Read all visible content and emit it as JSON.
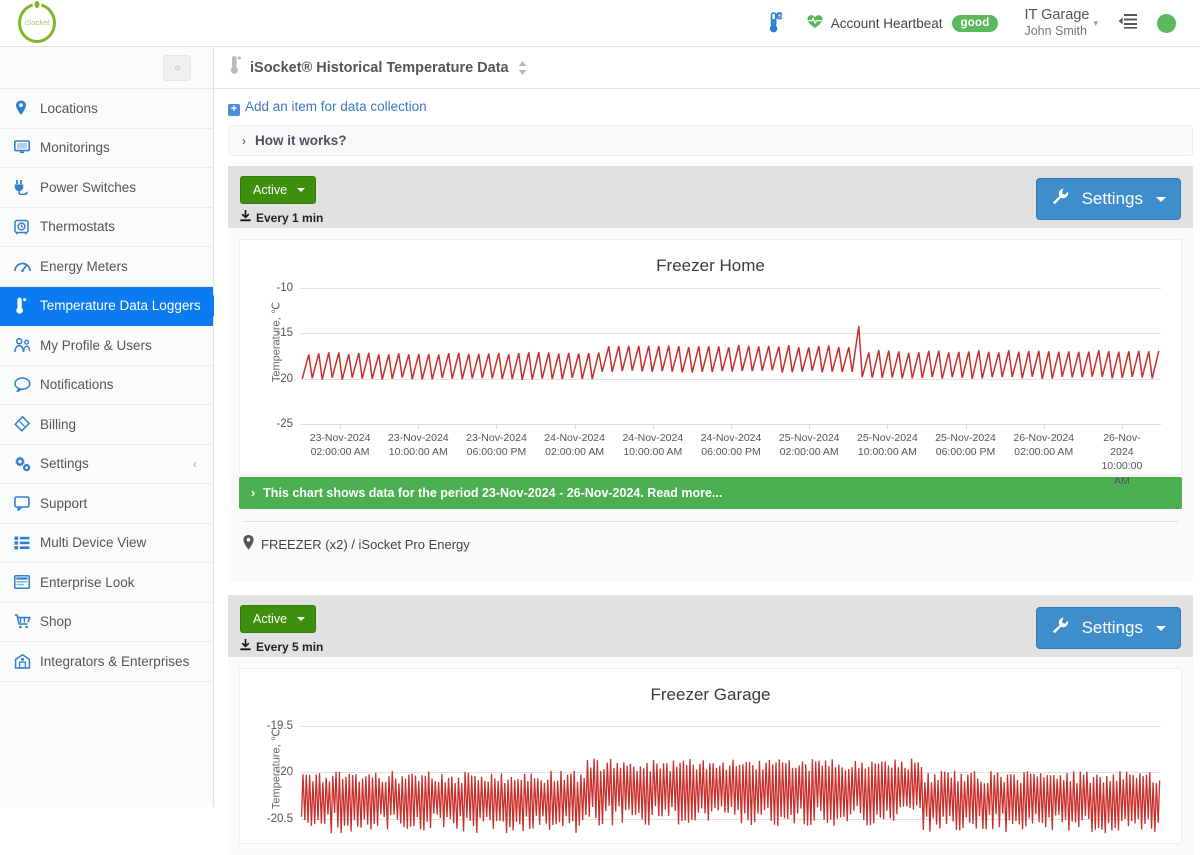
{
  "brand": {
    "name": "iSocket",
    "logo_text": "iSocket",
    "accent_green": "#7cb925"
  },
  "topbar": {
    "thermo_icon": "thermometer-celsius-icon",
    "heartbeat_icon": "heart-pulse-icon",
    "heartbeat_label": "Account Heartbeat",
    "heartbeat_status": "good",
    "account_name": "IT Garage",
    "user_name": "John Smith",
    "caret": "⌄",
    "list_icon": "indent-list-icon",
    "status_dot": "online-status-dot",
    "status_color": "#5cb85c"
  },
  "sidebar": {
    "collapse_label": "‹›",
    "items": [
      {
        "label": "Locations",
        "icon": "map-pin-icon",
        "active": false
      },
      {
        "label": "Monitorings",
        "icon": "monitor-icon",
        "active": false
      },
      {
        "label": "Power Switches",
        "icon": "plug-icon",
        "active": false
      },
      {
        "label": "Thermostats",
        "icon": "thermostat-icon",
        "active": false
      },
      {
        "label": "Energy Meters",
        "icon": "gauge-icon",
        "active": false
      },
      {
        "label": "Temperature Data Loggers",
        "icon": "thermometer-icon",
        "active": true
      },
      {
        "label": "My Profile & Users",
        "icon": "users-icon",
        "active": false
      },
      {
        "label": "Notifications",
        "icon": "speech-bubble-icon",
        "active": false
      },
      {
        "label": "Billing",
        "icon": "tag-icon",
        "active": false
      },
      {
        "label": "Settings",
        "icon": "gears-icon",
        "active": false,
        "chevron": "‹"
      },
      {
        "label": "Support",
        "icon": "support-chat-icon",
        "active": false
      },
      {
        "label": "Multi Device View",
        "icon": "list-grid-icon",
        "active": false
      },
      {
        "label": "Enterprise Look",
        "icon": "window-icon",
        "active": false
      },
      {
        "label": "Shop",
        "icon": "cart-icon",
        "active": false
      },
      {
        "label": "Integrators & Enterprises",
        "icon": "network-icon",
        "active": false
      }
    ]
  },
  "page": {
    "title": "iSocket® Historical Temperature Data",
    "title_icon": "thermometer-icon",
    "sort_icon": "sort-updown-icon",
    "add_item_label": "Add an item for data collection",
    "add_icon": "plus-square-icon",
    "how_it_works_label": "How it works?",
    "how_it_works_chevron": "›"
  },
  "cards": [
    {
      "status_label": "Active",
      "status_caret": "▾",
      "interval_label": "Every 1 min",
      "interval_icon": "download-icon",
      "settings_label": "Settings",
      "settings_icon": "wrench-icon",
      "settings_caret": "▾",
      "note_chevron": "›",
      "note_text": "This chart shows data for the period 23-Nov-2024 - 26-Nov-2024. Read more...",
      "footer_icon": "map-pin-icon",
      "footer_text": "FREEZER (x2) / iSocket Pro Energy"
    },
    {
      "status_label": "Active",
      "status_caret": "▾",
      "interval_label": "Every 5 min",
      "interval_icon": "download-icon",
      "settings_label": "Settings",
      "settings_icon": "wrench-icon",
      "settings_caret": "▾"
    }
  ],
  "chart_data": [
    {
      "type": "line",
      "title": "Freezer Home",
      "xlabel": "",
      "ylabel": "Temperature, ℃",
      "ylim": [
        -25,
        -10
      ],
      "yticks": [
        -10,
        -15,
        -20,
        -25
      ],
      "ytick_labels": [
        "-10",
        "-15",
        "-20",
        "-25"
      ],
      "grid": true,
      "legend": "none",
      "line_color": "#c9302c",
      "x_tick_labels": [
        [
          "23-Nov-2024",
          "02:00:00 AM"
        ],
        [
          "23-Nov-2024",
          "10:00:00 AM"
        ],
        [
          "23-Nov-2024",
          "06:00:00 PM"
        ],
        [
          "24-Nov-2024",
          "02:00:00 AM"
        ],
        [
          "24-Nov-2024",
          "10:00:00 AM"
        ],
        [
          "24-Nov-2024",
          "06:00:00 PM"
        ],
        [
          "25-Nov-2024",
          "02:00:00 AM"
        ],
        [
          "25-Nov-2024",
          "10:00:00 AM"
        ],
        [
          "25-Nov-2024",
          "06:00:00 PM"
        ],
        [
          "26-Nov-2024",
          "02:00:00 AM"
        ],
        [
          "26-Nov-2024",
          "10:00:00 AM"
        ]
      ],
      "period_start": "23-Nov-2024",
      "period_end": "26-Nov-2024",
      "description": "Sawtooth freezer duty cycle oscillating roughly between -20 and -17 degrees C, with an isolated warm spike reaching about -14 near 25-Nov-2024 08:00 AM.",
      "series": [
        {
          "name": "Freezer Home",
          "cycle_min": -20.0,
          "cycle_max": -17.0,
          "cycle_count": 86,
          "spike": {
            "index": 55,
            "value": -14.2
          },
          "phases": [
            {
              "from": 0,
              "to": 30,
              "min": -20.0,
              "max": -17.2
            },
            {
              "from": 30,
              "to": 56,
              "min": -19.2,
              "max": -16.4
            },
            {
              "from": 56,
              "to": 86,
              "min": -19.9,
              "max": -17.0
            }
          ]
        }
      ]
    },
    {
      "type": "line",
      "title": "Freezer Garage",
      "xlabel": "",
      "ylabel": "Temperature, ℃",
      "ylim": [
        -20.7,
        -19.4
      ],
      "yticks": [
        -19.5,
        -20,
        -20.5
      ],
      "ytick_labels": [
        "-19.5",
        "-20",
        "-20.5"
      ],
      "grid": true,
      "legend": "none",
      "line_color": "#c9302c",
      "description": "Dense high-frequency noise band oscillating between about -20.55 and -20.05 degrees C, rising slightly mid-range with peaks touching -19.95.",
      "series": [
        {
          "name": "Freezer Garage",
          "band_min": -20.55,
          "band_max": -20.05,
          "cycle_count": 260
        }
      ]
    }
  ]
}
